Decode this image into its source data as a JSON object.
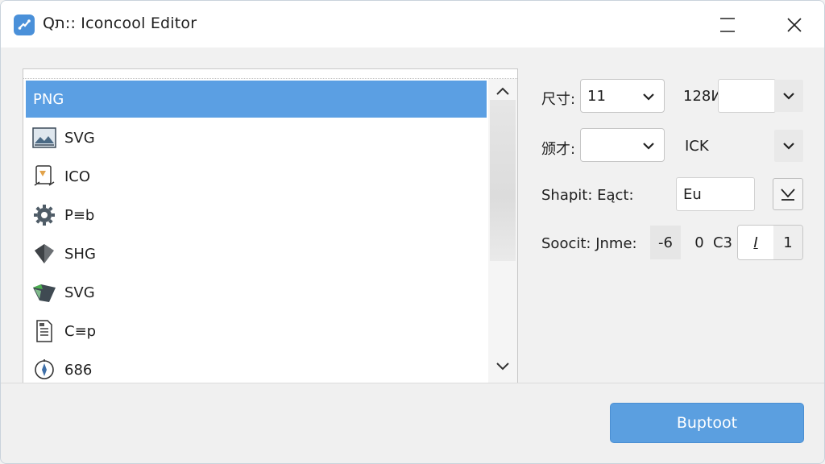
{
  "window": {
    "title": "Qת:: Iconcool Editor",
    "accent_color": "#5b9fe3"
  },
  "list": {
    "items": [
      {
        "label": "PNG",
        "icon": "none",
        "selected": true
      },
      {
        "label": "SVG",
        "icon": "image-icon",
        "selected": false
      },
      {
        "label": "ICO",
        "icon": "edit-doc-icon",
        "selected": false
      },
      {
        "label": "P≡b",
        "icon": "gear-icon",
        "selected": false
      },
      {
        "label": "SHG",
        "icon": "cube-icon",
        "selected": false
      },
      {
        "label": "SVG",
        "icon": "arrow-shape-icon",
        "selected": false
      },
      {
        "label": "C≡p",
        "icon": "document-icon",
        "selected": false
      },
      {
        "label": "686",
        "icon": "compass-icon",
        "selected": false
      }
    ]
  },
  "form": {
    "size_label": "尺寸:",
    "size_value": "11",
    "size2_label": "128И",
    "row2_label": "颁才:",
    "row2_value": "",
    "ick_label": "ICK",
    "shape_label": "Shapit: Eąct:",
    "shape_value": "Eu",
    "scale_label": "Soocit: Jnme:",
    "scale_minus": "-6",
    "scale_zero": "0",
    "scale_c3": "C3",
    "scale_italic": "I",
    "scale_one": "1"
  },
  "footer": {
    "primary_button": "Buptoot"
  }
}
